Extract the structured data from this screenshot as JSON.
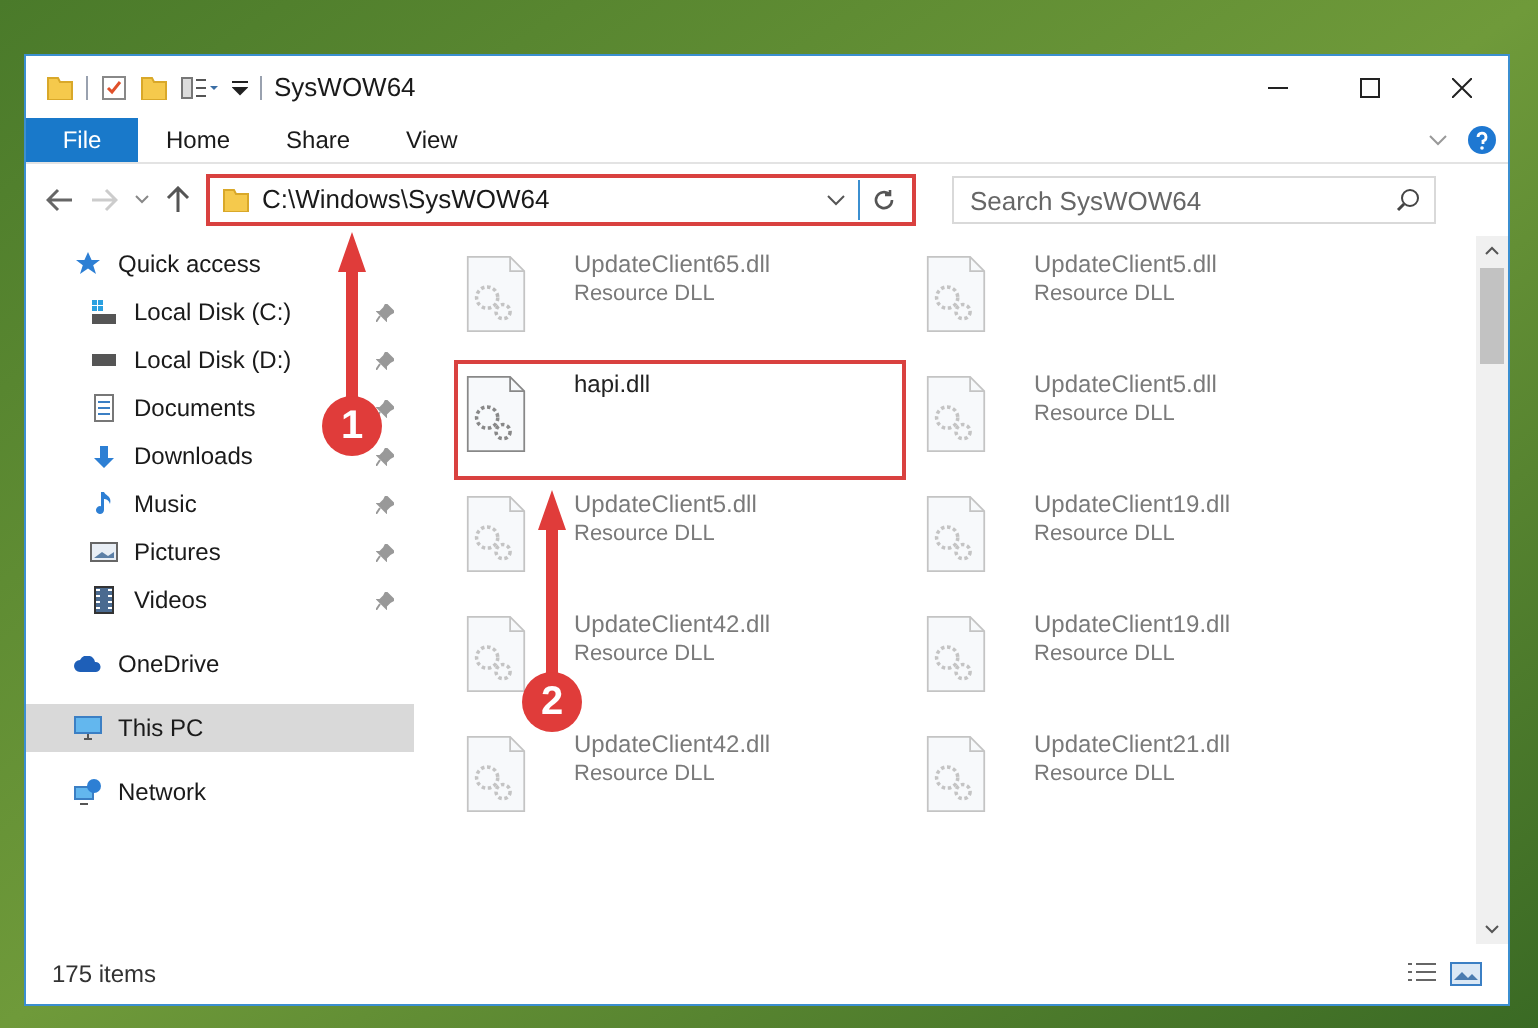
{
  "window": {
    "title": "SysWOW64"
  },
  "ribbon_tabs": [
    {
      "label": "File",
      "kind": "file"
    },
    {
      "label": "Home",
      "kind": "tab"
    },
    {
      "label": "Share",
      "kind": "tab"
    },
    {
      "label": "View",
      "kind": "tab"
    }
  ],
  "address_bar": {
    "path": "C:\\Windows\\SysWOW64",
    "highlighted": true
  },
  "search": {
    "placeholder": "Search SysWOW64"
  },
  "sidebar": [
    {
      "label": "Quick access",
      "selected": false,
      "children": [
        {
          "label": "Local Disk (C:)",
          "pinned": true
        },
        {
          "label": "Local Disk (D:)",
          "pinned": true
        },
        {
          "label": "Documents",
          "pinned": true
        },
        {
          "label": "Downloads",
          "pinned": true
        },
        {
          "label": "Music",
          "pinned": true
        },
        {
          "label": "Pictures",
          "pinned": true
        },
        {
          "label": "Videos",
          "pinned": true
        }
      ]
    },
    {
      "label": "OneDrive",
      "selected": false
    },
    {
      "label": "This PC",
      "selected": true
    },
    {
      "label": "Network",
      "selected": false
    }
  ],
  "files": [
    {
      "name": "UpdateClient65.dll",
      "type": "Resource DLL",
      "faded": true,
      "highlighted": false
    },
    {
      "name": "UpdateClient5.dll",
      "type": "Resource DLL",
      "faded": true,
      "highlighted": false
    },
    {
      "name": "hapi.dll",
      "faded": false,
      "highlighted": true
    },
    {
      "name": "UpdateClient5.dll",
      "type": "Resource DLL",
      "faded": true,
      "highlighted": false
    },
    {
      "name": "UpdateClient5.dll",
      "type": "Resource DLL",
      "faded": true,
      "highlighted": false
    },
    {
      "name": "UpdateClient19.dll",
      "type": "Resource DLL",
      "faded": true,
      "highlighted": false
    },
    {
      "name": "UpdateClient42.dll",
      "type": "Resource DLL",
      "faded": true,
      "highlighted": false
    },
    {
      "name": "UpdateClient19.dll",
      "type": "Resource DLL",
      "faded": true,
      "highlighted": false
    },
    {
      "name": "UpdateClient42.dll",
      "type": "Resource DLL",
      "faded": true,
      "highlighted": false
    },
    {
      "name": "UpdateClient21.dll",
      "type": "Resource DLL",
      "faded": true,
      "highlighted": false
    }
  ],
  "status_bar": {
    "item_count": "175 items"
  },
  "callouts": [
    {
      "number": "1"
    },
    {
      "number": "2"
    }
  ]
}
